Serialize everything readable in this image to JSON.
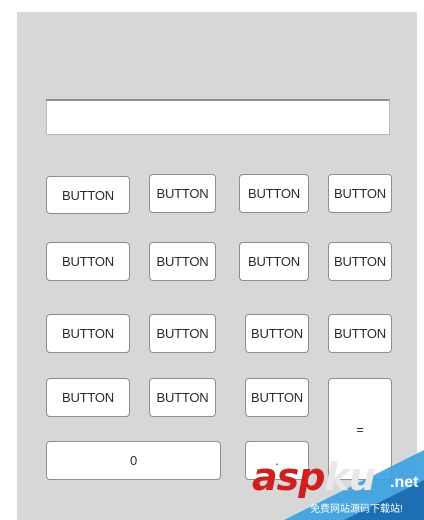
{
  "display": {
    "value": ""
  },
  "keypad": {
    "row1": [
      "BUTTON",
      "BUTTON",
      "BUTTON",
      "BUTTON"
    ],
    "row2": [
      "BUTTON",
      "BUTTON",
      "BUTTON",
      "BUTTON"
    ],
    "row3": [
      "BUTTON",
      "BUTTON",
      "BUTTON",
      "BUTTON"
    ],
    "row4": [
      "BUTTON",
      "BUTTON",
      "BUTTON"
    ],
    "equals": "=",
    "zero": "0",
    "dot": "."
  },
  "watermark": {
    "brand_a": "asp",
    "brand_b": "ku",
    "domain": ".net",
    "tagline": "免费网站源码下载站!"
  },
  "colors": {
    "panel": "#d7d7d7",
    "button_bg": "#ffffff",
    "button_border": "#8e8e8e",
    "watermark_red": "#d11f1f",
    "watermark_blue": "#3aa0e0"
  }
}
